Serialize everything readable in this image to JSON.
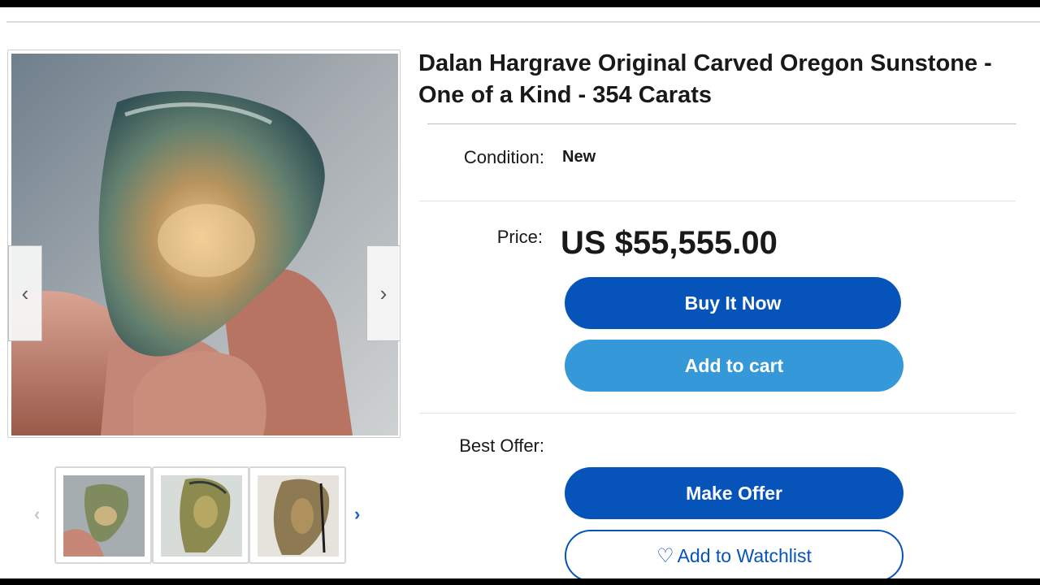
{
  "listing": {
    "title": "Dalan Hargrave Original Carved Oregon Sunstone - One of a Kind - 354 Carats",
    "condition_label": "Condition:",
    "condition_value": "New",
    "price_label": "Price:",
    "price": "US $55,555.00",
    "best_offer_label": "Best Offer:"
  },
  "actions": {
    "buy_now": "Buy It Now",
    "add_to_cart": "Add to cart",
    "make_offer": "Make Offer",
    "watchlist": "Add to Watchlist"
  },
  "gallery": {
    "prev_icon": "‹",
    "next_icon": "›",
    "thumb_prev_icon": "‹",
    "thumb_next_icon": "›",
    "thumbnail_count": 3
  },
  "icons": {
    "heart": "♡"
  },
  "colors": {
    "primary_button": "#0654ba",
    "secondary_button": "#3498d9"
  }
}
